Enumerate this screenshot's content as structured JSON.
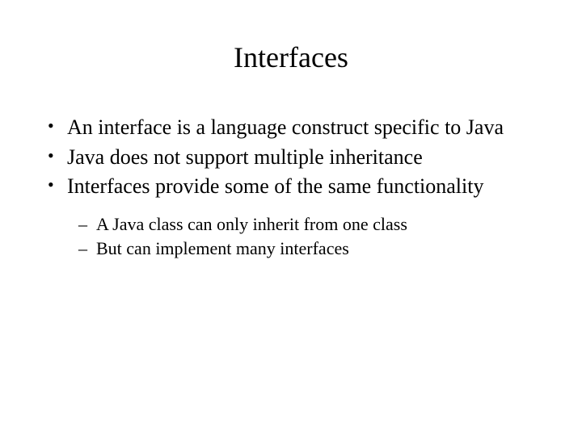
{
  "title": "Interfaces",
  "bullets": [
    "An interface is a language construct specific to Java",
    "Java does not support multiple inheritance",
    "Interfaces provide some of the same functionality"
  ],
  "sub_bullets": [
    "A Java class can only inherit from one class",
    "But can implement many interfaces"
  ]
}
